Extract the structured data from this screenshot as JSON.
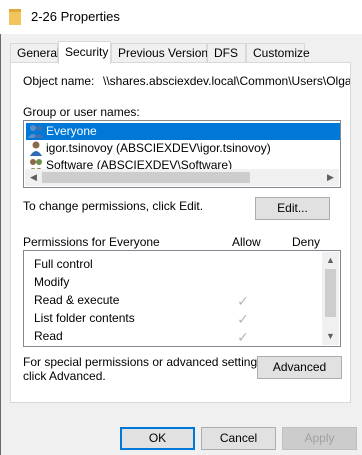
{
  "window": {
    "title": "2-26 Properties"
  },
  "tabs": [
    {
      "label": "General"
    },
    {
      "label": "Security"
    },
    {
      "label": "Previous Versions"
    },
    {
      "label": "DFS"
    },
    {
      "label": "Customize"
    }
  ],
  "active_tab": "Security",
  "object": {
    "label": "Object name:",
    "value": "\\\\shares.absciexdev.local\\Common\\Users\\Olga.Ta"
  },
  "groups": {
    "label": "Group or user names:",
    "items": [
      {
        "name": "Everyone",
        "icon": "group-icon",
        "selected": true
      },
      {
        "name": "igor.tsinovoy (ABSCIEXDEV\\igor.tsinovoy)",
        "icon": "user-icon",
        "selected": false
      },
      {
        "name": "Software (ABSCIEXDEV\\Software)",
        "icon": "group-icon",
        "selected": false
      }
    ]
  },
  "change_text": "To change permissions, click Edit.",
  "edit_button": "Edit...",
  "permissions": {
    "header": "Permissions for Everyone",
    "allow_label": "Allow",
    "deny_label": "Deny",
    "rows": [
      {
        "name": "Full control",
        "allow": false,
        "deny": false
      },
      {
        "name": "Modify",
        "allow": false,
        "deny": false
      },
      {
        "name": "Read & execute",
        "allow": true,
        "deny": false
      },
      {
        "name": "List folder contents",
        "allow": true,
        "deny": false
      },
      {
        "name": "Read",
        "allow": true,
        "deny": false
      }
    ]
  },
  "special": {
    "line1": "For special permissions or advanced settings,",
    "line2": "click Advanced."
  },
  "advanced_button": "Advanced",
  "footer": {
    "ok": "OK",
    "cancel": "Cancel",
    "apply": "Apply"
  },
  "colors": {
    "selection": "#0078d7",
    "check_inherited": "#b4b4b4",
    "folder": "#f2c55c"
  }
}
